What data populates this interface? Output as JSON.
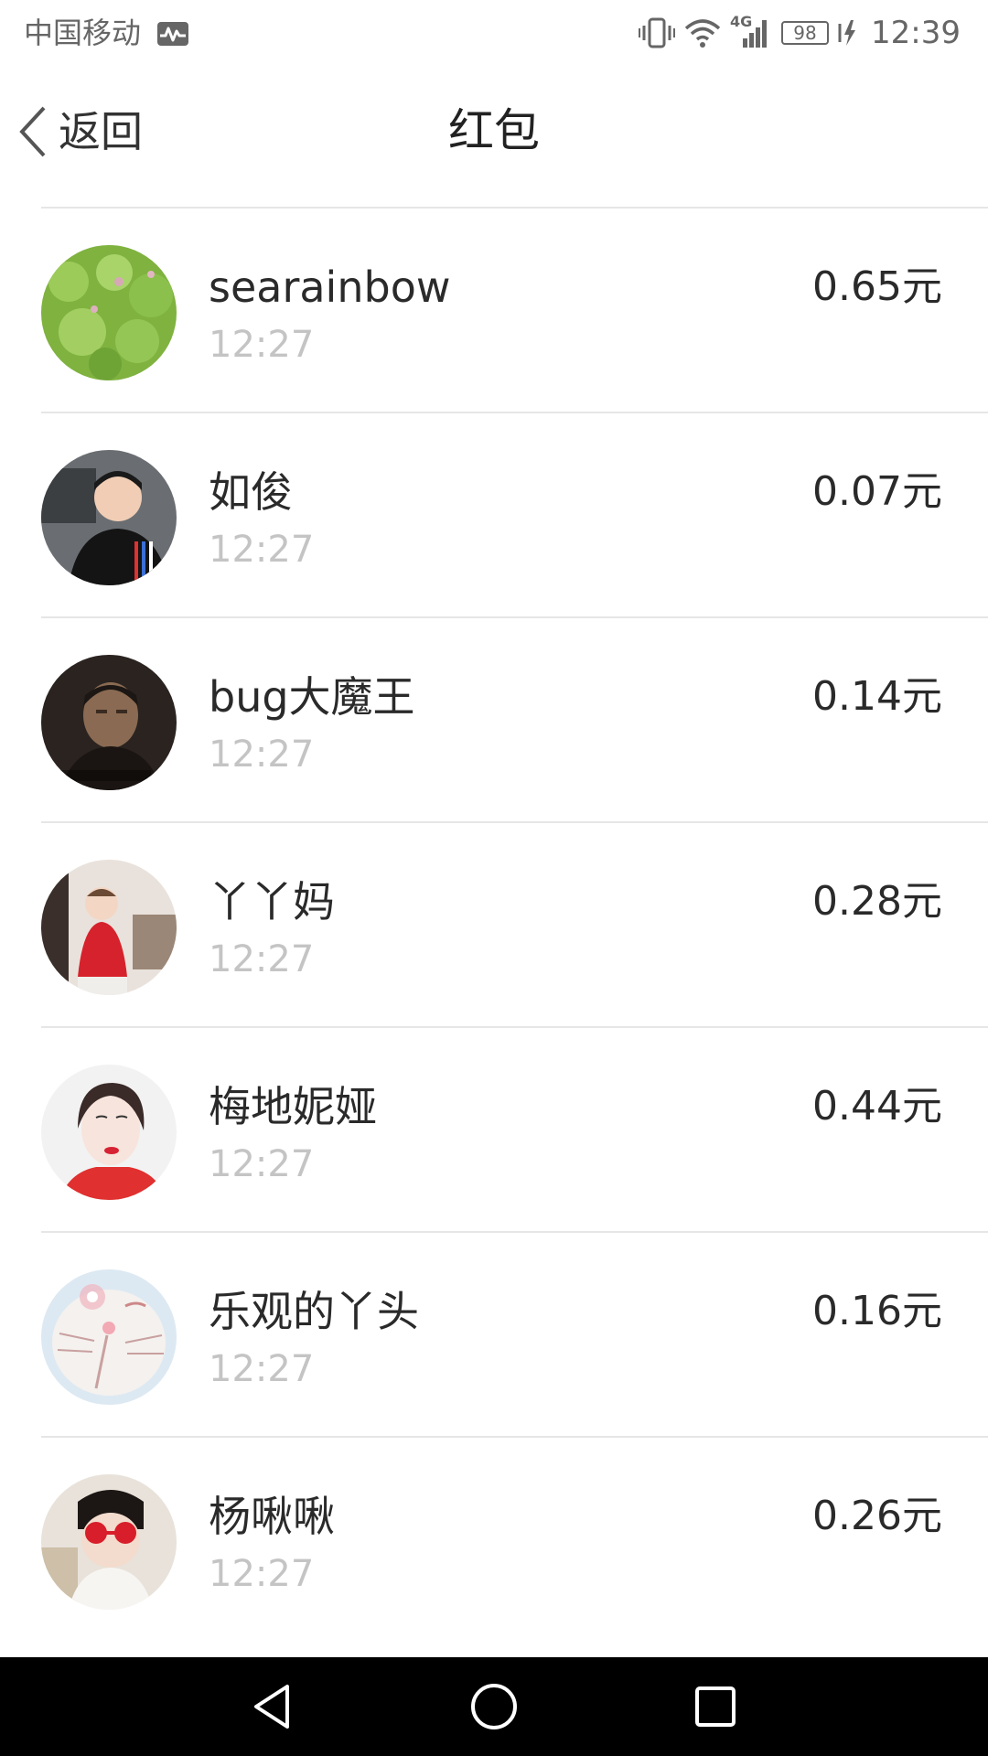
{
  "status_bar": {
    "carrier": "中国移动",
    "network": "4G",
    "battery": "98",
    "time": "12:39"
  },
  "header": {
    "back_label": "返回",
    "title": "红包"
  },
  "list": {
    "items": [
      {
        "name": "searainbow",
        "time": "12:27",
        "amount": "0.65元",
        "avatar": "avatar-green-clover"
      },
      {
        "name": "如俊",
        "time": "12:27",
        "amount": "0.07元",
        "avatar": "avatar-boy-black-sweater"
      },
      {
        "name": "bug大魔王",
        "time": "12:27",
        "amount": "0.14元",
        "avatar": "avatar-man-dark"
      },
      {
        "name": "丫丫妈",
        "time": "12:27",
        "amount": "0.28元",
        "avatar": "avatar-child-red"
      },
      {
        "name": "梅地妮娅",
        "time": "12:27",
        "amount": "0.44元",
        "avatar": "avatar-woman-portrait"
      },
      {
        "name": "乐观的丫头",
        "time": "12:27",
        "amount": "0.16元",
        "avatar": "avatar-cartoon-cat"
      },
      {
        "name": "杨啾啾",
        "time": "12:27",
        "amount": "0.26元",
        "avatar": "avatar-child-sunglasses"
      }
    ]
  },
  "colors": {
    "text_primary": "#2a2a2a",
    "text_secondary": "#c4c4c4",
    "divider": "#e6e6e6",
    "nav_bar": "#000000"
  }
}
